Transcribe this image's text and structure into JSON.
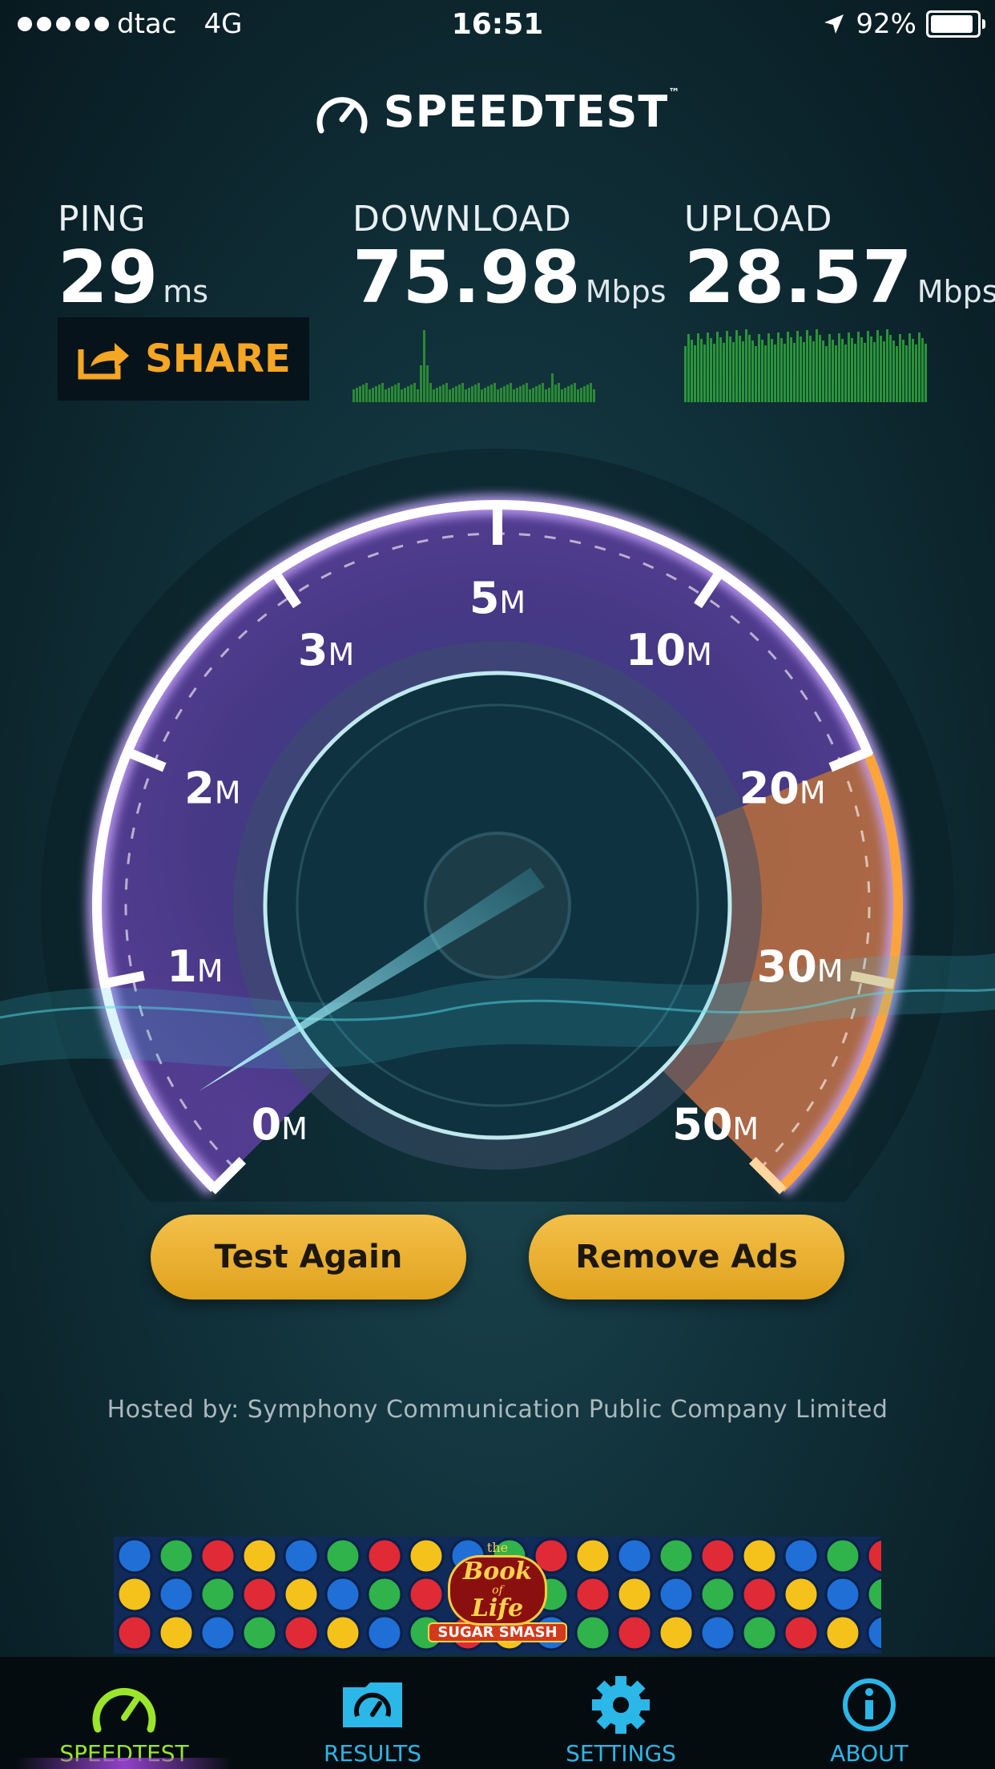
{
  "status_bar": {
    "carrier": "dtac",
    "network": "4G",
    "time": "16:51",
    "battery": "92%"
  },
  "header": {
    "title": "SPEEDTEST",
    "tm": "™"
  },
  "ping": {
    "label": "PING",
    "value": "29",
    "unit": "ms"
  },
  "download": {
    "label": "DOWNLOAD",
    "value": "75.98",
    "unit": "Mbps"
  },
  "upload": {
    "label": "UPLOAD",
    "value": "28.57",
    "unit": "Mbps"
  },
  "share": {
    "label": "SHARE"
  },
  "gauge": {
    "ticks": [
      {
        "num": "0",
        "unit": "M"
      },
      {
        "num": "1",
        "unit": "M"
      },
      {
        "num": "2",
        "unit": "M"
      },
      {
        "num": "3",
        "unit": "M"
      },
      {
        "num": "5",
        "unit": "M"
      },
      {
        "num": "10",
        "unit": "M"
      },
      {
        "num": "20",
        "unit": "M"
      },
      {
        "num": "30",
        "unit": "M"
      },
      {
        "num": "50",
        "unit": "M"
      }
    ]
  },
  "buttons": {
    "test_again": "Test Again",
    "remove_ads": "Remove Ads"
  },
  "hosted": "Hosted by: Symphony Communication Public Company Limited",
  "ad": {
    "logo_top": "the",
    "logo_mid1": "Book",
    "logo_of": "of",
    "logo_mid2": "Life",
    "logo_banner": "SUGAR SMASH"
  },
  "tabs": [
    {
      "label": "SPEEDTEST"
    },
    {
      "label": "RESULTS"
    },
    {
      "label": "SETTINGS"
    },
    {
      "label": "ABOUT"
    }
  ],
  "colors": {
    "accent_green": "#9be62b",
    "accent_blue": "#2bb7e8",
    "share_orange": "#f5a623",
    "button_gold": "#e9ae2a"
  }
}
